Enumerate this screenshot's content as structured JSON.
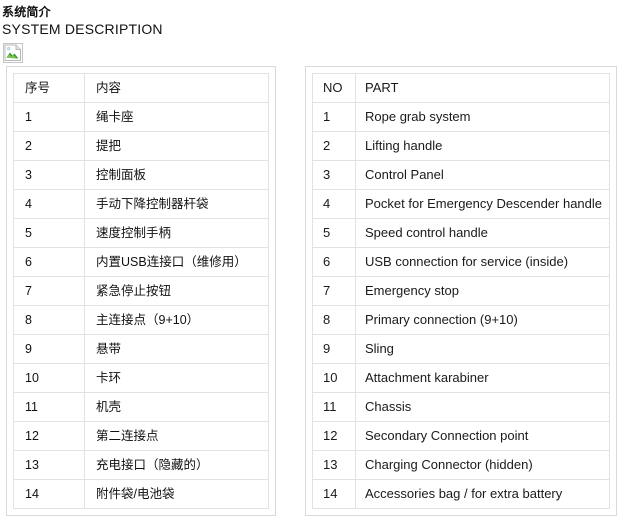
{
  "heading": {
    "title_cn": "系统简介",
    "title_en": "SYSTEM DESCRIPTION"
  },
  "media": {
    "placeholder_icon": "broken-image-icon",
    "alt": ""
  },
  "colors": {
    "text": "#111111",
    "table_border": "#e2e2e2",
    "shell_border": "#d9d9d9",
    "background": "#ffffff"
  },
  "tables": {
    "left": {
      "name": "chinese-parts-table",
      "columns": [
        "序号",
        "内容"
      ],
      "rows": [
        [
          "1",
          "绳卡座"
        ],
        [
          "2",
          "提把"
        ],
        [
          "3",
          "控制面板"
        ],
        [
          "4",
          "手动下降控制器杆袋"
        ],
        [
          "5",
          "速度控制手柄"
        ],
        [
          "6",
          "内置USB连接口（维修用）"
        ],
        [
          "7",
          "紧急停止按钮"
        ],
        [
          "8",
          "主连接点（9+10）"
        ],
        [
          "9",
          "悬带"
        ],
        [
          "10",
          "卡环"
        ],
        [
          "11",
          "机壳"
        ],
        [
          "12",
          "第二连接点"
        ],
        [
          "13",
          "充电接口（隐藏的）"
        ],
        [
          "14",
          "附件袋/电池袋"
        ]
      ]
    },
    "right": {
      "name": "english-parts-table",
      "columns": [
        "NO",
        "PART"
      ],
      "rows": [
        [
          "1",
          "Rope grab system"
        ],
        [
          "2",
          "Lifting handle"
        ],
        [
          "3",
          "Control Panel"
        ],
        [
          "4",
          "Pocket for Emergency Descender handle"
        ],
        [
          "5",
          "Speed control handle"
        ],
        [
          "6",
          "USB connection for service (inside)"
        ],
        [
          "7",
          "Emergency stop"
        ],
        [
          "8",
          "Primary connection (9+10)"
        ],
        [
          "9",
          "Sling"
        ],
        [
          "10",
          "Attachment karabiner"
        ],
        [
          "11",
          "Chassis"
        ],
        [
          "12",
          "Secondary Connection point"
        ],
        [
          "13",
          "Charging Connector (hidden)"
        ],
        [
          "14",
          "Accessories bag / for extra battery"
        ]
      ]
    }
  }
}
